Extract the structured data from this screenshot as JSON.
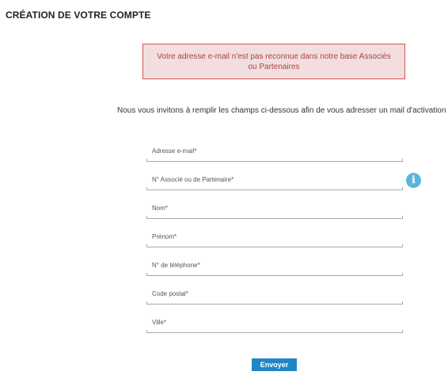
{
  "page": {
    "title": "CRÉATION DE VOTRE COMPTE"
  },
  "alert": {
    "message": "Votre adresse e-mail n'est pas reconnue dans notre base Associés ou Partenaires"
  },
  "intro": {
    "text": "Nous vous invitons à remplir les champs ci-dessous afin de vous adresser un mail d'activation"
  },
  "form": {
    "fields": [
      {
        "label": "Adresse e-mail*",
        "value": ""
      },
      {
        "label": "N° Associé ou de Partenaire*",
        "value": ""
      },
      {
        "label": "Nom*",
        "value": ""
      },
      {
        "label": "Prénom*",
        "value": ""
      },
      {
        "label": "N° de téléphone*",
        "value": ""
      },
      {
        "label": "Code postal*",
        "value": ""
      },
      {
        "label": "Ville*",
        "value": ""
      }
    ],
    "info_icon": {
      "icon": "info-icon",
      "glyph": "i",
      "color": "#5bb5dc"
    },
    "submit_label": "Envoyer"
  },
  "colors": {
    "alert_background": "#f2dede",
    "alert_border": "#d9534f",
    "alert_text": "#a94442",
    "button_background": "#1e87c6"
  }
}
